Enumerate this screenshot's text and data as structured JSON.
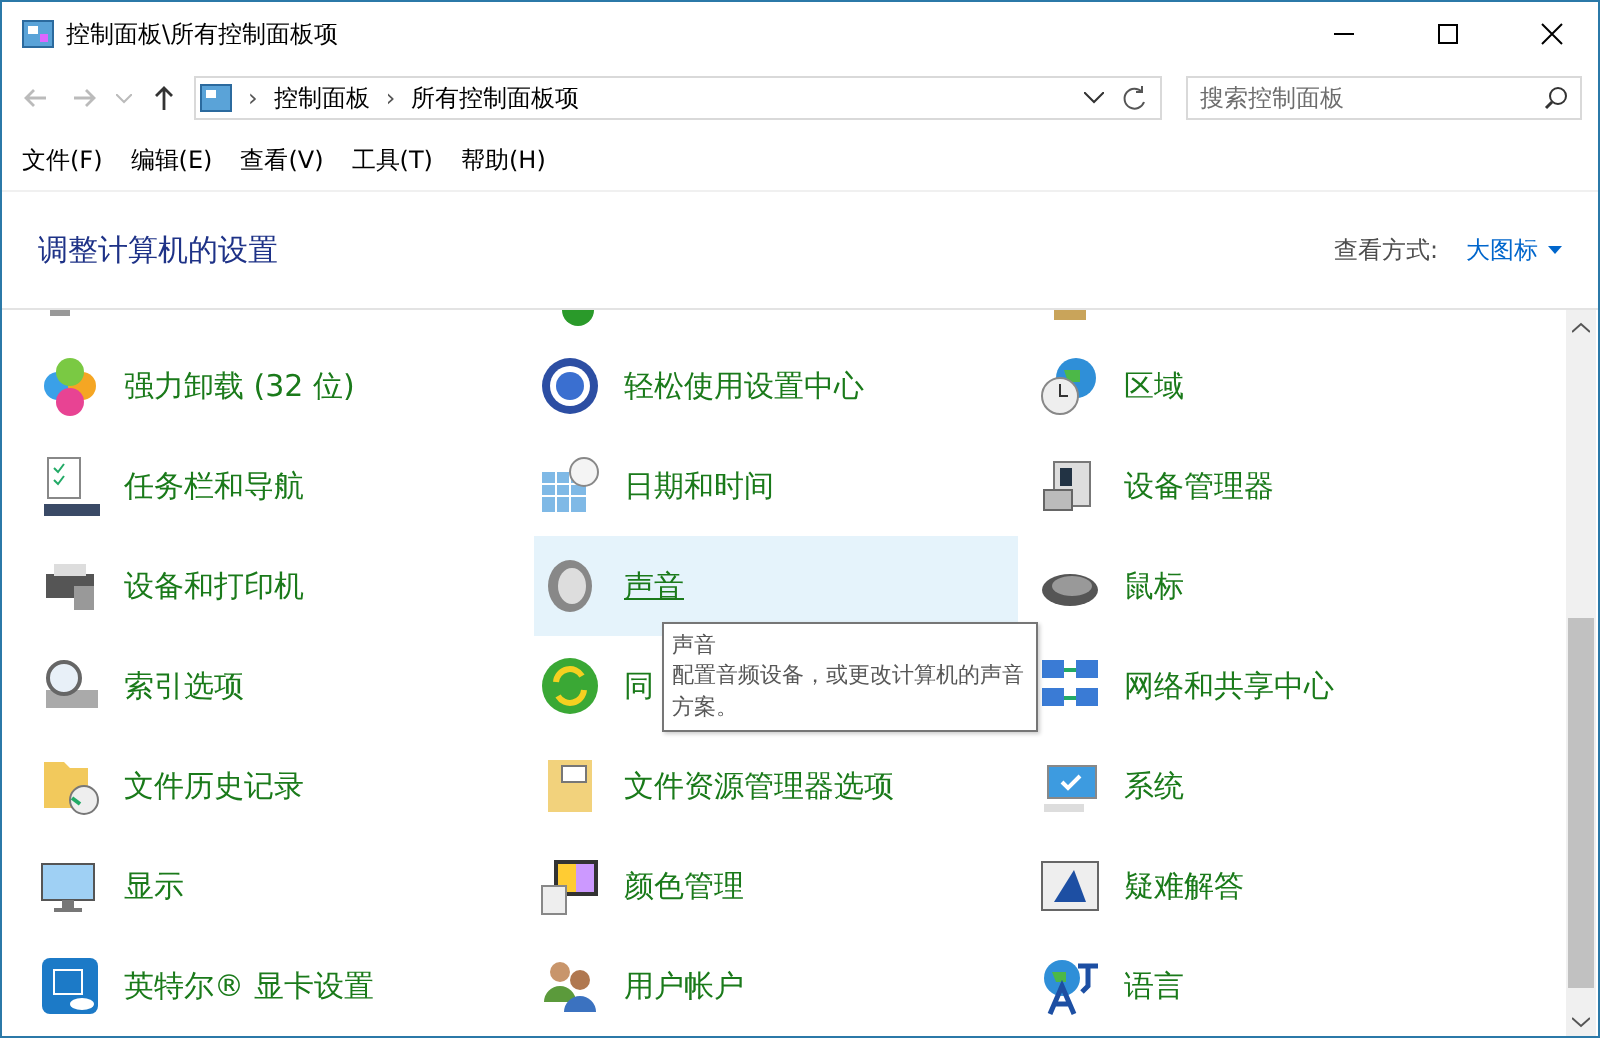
{
  "window": {
    "title": "控制面板\\所有控制面板项"
  },
  "address": {
    "crumbs": [
      "控制面板",
      "所有控制面板项"
    ],
    "separator": "›"
  },
  "search": {
    "placeholder": "搜索控制面板"
  },
  "menu": [
    "文件(F)",
    "编辑(E)",
    "查看(V)",
    "工具(T)",
    "帮助(H)"
  ],
  "header": {
    "title": "调整计算机的设置",
    "view_label": "查看方式:",
    "view_value": "大图标"
  },
  "items": [
    {
      "label": "强力卸载 (32 位)",
      "selected": false
    },
    {
      "label": "轻松使用设置中心",
      "selected": false
    },
    {
      "label": "区域",
      "selected": false
    },
    {
      "label": "任务栏和导航",
      "selected": false
    },
    {
      "label": "日期和时间",
      "selected": false
    },
    {
      "label": "设备管理器",
      "selected": false
    },
    {
      "label": "设备和打印机",
      "selected": false
    },
    {
      "label": "声音",
      "selected": true
    },
    {
      "label": "鼠标",
      "selected": false
    },
    {
      "label": "索引选项",
      "selected": false
    },
    {
      "label": "同",
      "selected": false
    },
    {
      "label": "网络和共享中心",
      "selected": false
    },
    {
      "label": "文件历史记录",
      "selected": false
    },
    {
      "label": "文件资源管理器选项",
      "selected": false
    },
    {
      "label": "系统",
      "selected": false
    },
    {
      "label": "显示",
      "selected": false
    },
    {
      "label": "颜色管理",
      "selected": false
    },
    {
      "label": "疑难解答",
      "selected": false
    },
    {
      "label": "英特尔® 显卡设置",
      "selected": false
    },
    {
      "label": "用户帐户",
      "selected": false
    },
    {
      "label": "语言",
      "selected": false
    }
  ],
  "tooltip": {
    "title": "声音",
    "text": "配置音频设备，或更改计算机的声音方案。"
  }
}
